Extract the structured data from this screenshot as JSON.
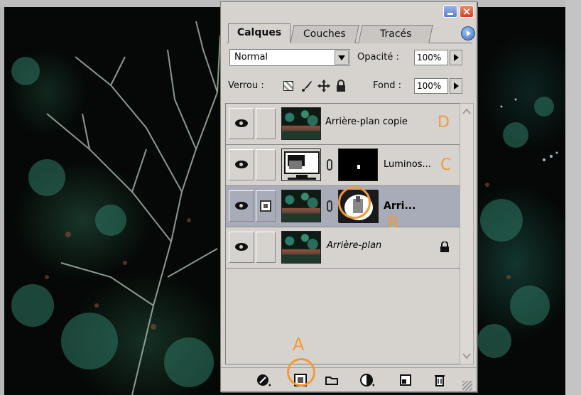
{
  "palette": {
    "tabs": [
      {
        "label": "Calques",
        "active": true
      },
      {
        "label": "Couches",
        "active": false
      },
      {
        "label": "Tracés",
        "active": false
      }
    ],
    "blend_mode": "Normal",
    "opacity_label": "Opacité :",
    "opacity_value": "100%",
    "lock_label": "Verrou :",
    "fill_label": "Fond :",
    "fill_value": "100%",
    "layers": [
      {
        "name": "Arrière-plan copie",
        "visible": true,
        "annotation": "D"
      },
      {
        "name": "Luminos...",
        "visible": true,
        "annotation": "C"
      },
      {
        "name": "Arri...",
        "visible": true,
        "annotation": "B",
        "selected": true
      },
      {
        "name": "Arrière-plan",
        "visible": true,
        "locked": true
      }
    ],
    "bottom_annotation": "A"
  },
  "colors": {
    "annotation": "#f29a3a",
    "selected_row": "#a7acb8",
    "panel": "#d6d3ce"
  },
  "icons": {
    "lock_row": [
      "lock-transparent-icon",
      "lock-brush-icon",
      "lock-move-icon",
      "lock-all-icon"
    ],
    "bottom_bar": [
      "layer-style-icon",
      "add-mask-icon",
      "new-set-icon",
      "adjustment-layer-icon",
      "new-layer-icon",
      "trash-icon"
    ]
  }
}
